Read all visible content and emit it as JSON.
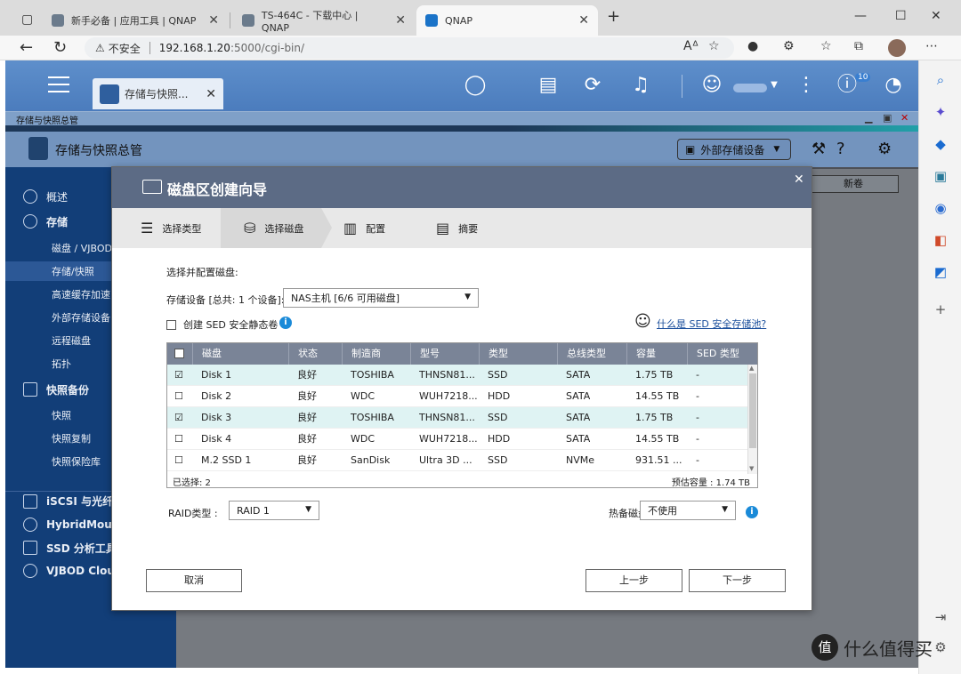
{
  "browser": {
    "tabs": [
      {
        "title": "新手必备 | 应用工具 | QNAP"
      },
      {
        "title": "TS-464C - 下载中心 | QNAP"
      },
      {
        "title": "QNAP"
      }
    ],
    "security_label": "不安全",
    "url_host": "192.168.1.20",
    "url_path": ":5000/cgi-bin/"
  },
  "qts": {
    "app_tab_label": "存储与快照...",
    "notification_count": "10",
    "window_title": "存储与快照总管",
    "app_title": "存储与快照总管",
    "external_storage_button": "外部存储设备"
  },
  "sidebar": {
    "items": [
      {
        "label": "概述"
      },
      {
        "label": "存储"
      },
      {
        "label": "磁盘 / VJBOD"
      },
      {
        "label": "存储/快照"
      },
      {
        "label": "高速缓存加速"
      },
      {
        "label": "外部存储设备"
      },
      {
        "label": "远程磁盘"
      },
      {
        "label": "拓扑"
      },
      {
        "label": "快照备份"
      },
      {
        "label": "快照"
      },
      {
        "label": "快照复制"
      },
      {
        "label": "快照保险库"
      },
      {
        "label": "iSCSI 与光纤通"
      },
      {
        "label": "HybridMount"
      },
      {
        "label": "SSD 分析工具"
      },
      {
        "label": "VJBOD Cloud"
      }
    ],
    "new_volume_button": "新卷"
  },
  "dialog": {
    "title": "磁盘区创建向导",
    "steps": [
      {
        "label": "选择类型"
      },
      {
        "label": "选择磁盘"
      },
      {
        "label": "配置"
      },
      {
        "label": "摘要"
      }
    ],
    "instruction": "选择并配置磁盘:",
    "device_label": "存储设备 [总共: 1 个设备]:",
    "device_value": "NAS主机 [6/6 可用磁盘]",
    "sed_checkbox_label": "创建 SED 安全静态卷",
    "sed_link": "什么是 SED 安全存储池?",
    "table": {
      "columns": [
        "磁盘",
        "状态",
        "制造商",
        "型号",
        "类型",
        "总线类型",
        "容量",
        "SED 类型"
      ],
      "rows": [
        {
          "checked": "☑",
          "disk": "Disk 1",
          "status": "良好",
          "vendor": "TOSHIBA",
          "model": "THNSN81...",
          "type": "SSD",
          "bus": "SATA",
          "capacity": "1.75 TB",
          "sed": "-"
        },
        {
          "checked": "☐",
          "disk": "Disk 2",
          "status": "良好",
          "vendor": "WDC",
          "model": "WUH7218...",
          "type": "HDD",
          "bus": "SATA",
          "capacity": "14.55 TB",
          "sed": "-"
        },
        {
          "checked": "☑",
          "disk": "Disk 3",
          "status": "良好",
          "vendor": "TOSHIBA",
          "model": "THNSN81...",
          "type": "SSD",
          "bus": "SATA",
          "capacity": "1.75 TB",
          "sed": "-"
        },
        {
          "checked": "☐",
          "disk": "Disk 4",
          "status": "良好",
          "vendor": "WDC",
          "model": "WUH7218...",
          "type": "HDD",
          "bus": "SATA",
          "capacity": "14.55 TB",
          "sed": "-"
        },
        {
          "checked": "☐",
          "disk": "M.2 SSD 1",
          "status": "良好",
          "vendor": "SanDisk",
          "model": "Ultra 3D ...",
          "type": "SSD",
          "bus": "NVMe",
          "capacity": "931.51 ...",
          "sed": "-"
        }
      ],
      "selected_count": "已选择: 2",
      "estimated_capacity": "预估容量 : 1.74 TB"
    },
    "raid_label": "RAID类型 :",
    "raid_value": "RAID 1",
    "spare_label": "热备磁盘 :",
    "spare_value": "不使用",
    "cancel_button": "取消",
    "prev_button": "上一步",
    "next_button": "下一步"
  },
  "watermark": {
    "logo_glyph": "值",
    "text": "什么值得买"
  },
  "colors": {
    "qts_blue": "#4b7cbd",
    "sidebar_navy": "#123e78",
    "dialog_title": "#5c6b85",
    "selected_row": "#dff3f3",
    "info_blue": "#1a8ad8"
  }
}
